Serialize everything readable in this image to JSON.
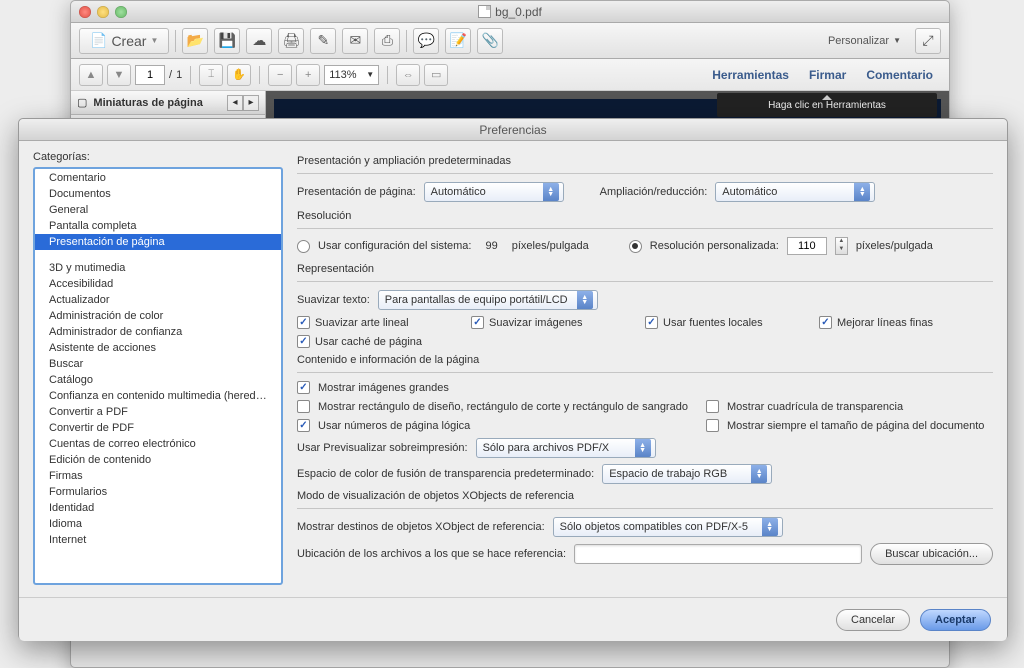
{
  "window": {
    "title": "bg_0.pdf"
  },
  "toolbar1": {
    "crear": "Crear",
    "personalizar": "Personalizar"
  },
  "toolbar2": {
    "page": "1",
    "pages": "1",
    "zoom": "113%",
    "herramientas": "Herramientas",
    "firmar": "Firmar",
    "comentario": "Comentario"
  },
  "sidebar": {
    "title": "Miniaturas de página"
  },
  "helpbar": "Haga clic en Herramientas",
  "prefs": {
    "title": "Preferencias",
    "cats_label": "Categorías:",
    "categories1": [
      "Comentario",
      "Documentos",
      "General",
      "Pantalla completa",
      "Presentación de página"
    ],
    "categories2": [
      "3D y mutimedia",
      "Accesibilidad",
      "Actualizador",
      "Administración de color",
      "Administrador de confianza",
      "Asistente de acciones",
      "Buscar",
      "Catálogo",
      "Confianza en contenido multimedia (heredado)",
      "Convertir a PDF",
      "Convertir de PDF",
      "Cuentas de correo electrónico",
      "Edición de contenido",
      "Firmas",
      "Formularios",
      "Identidad",
      "Idioma",
      "Internet"
    ],
    "sec1_title": "Presentación y ampliación predeterminadas",
    "pres_label": "Presentación de página:",
    "pres_value": "Automático",
    "amp_label": "Ampliación/reducción:",
    "amp_value": "Automático",
    "sec2_title": "Resolución",
    "res_sys": "Usar configuración del sistema:",
    "res_sys_val": "99",
    "res_unit": "píxeles/pulgada",
    "res_custom": "Resolución personalizada:",
    "res_custom_val": "110",
    "sec3_title": "Representación",
    "smooth_text": "Suavizar texto:",
    "smooth_text_val": "Para pantallas de equipo portátil/LCD",
    "cb_arte": "Suavizar arte lineal",
    "cb_img": "Suavizar imágenes",
    "cb_fonts": "Usar fuentes locales",
    "cb_lines": "Mejorar líneas finas",
    "cb_cache": "Usar caché de página",
    "sec4_title": "Contenido e información de la página",
    "cb_large": "Mostrar imágenes grandes",
    "cb_rect": "Mostrar rectángulo de diseño, rectángulo de corte y rectángulo de sangrado",
    "cb_grid": "Mostrar cuadrícula de transparencia",
    "cb_logic": "Usar números de página lógica",
    "cb_size": "Mostrar siempre el tamaño de página del documento",
    "overprint_label": "Usar Previsualizar sobreimpresión:",
    "overprint_val": "Sólo para archivos PDF/X",
    "blend_label": "Espacio de color de fusión de transparencia predeterminado:",
    "blend_val": "Espacio de trabajo RGB",
    "sec5_title": "Modo de visualización de objetos XObjects de referencia",
    "xobj_label": "Mostrar destinos de objetos XObject de referencia:",
    "xobj_val": "Sólo objetos compatibles con PDF/X-5",
    "loc_label": "Ubicación de los archivos a los que se hace referencia:",
    "browse": "Buscar ubicación...",
    "cancel": "Cancelar",
    "ok": "Aceptar"
  }
}
